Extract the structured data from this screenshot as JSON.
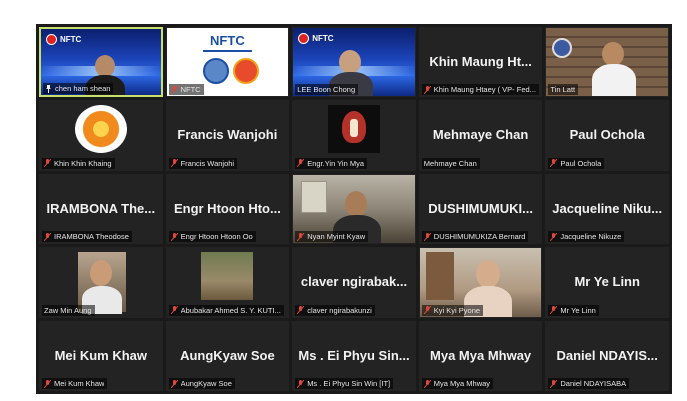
{
  "participants": [
    {
      "display_name": "",
      "caption": "chen ham shean",
      "has_video": true,
      "active": true,
      "pinned": true
    },
    {
      "display_name": "",
      "caption": "NFTC",
      "has_video": true,
      "logo_text": "NFTC"
    },
    {
      "display_name": "",
      "caption": "LEE Boon Chong",
      "has_video": true,
      "badge": "NFTC"
    },
    {
      "display_name": "Khin Maung Ht...",
      "caption": "Khin Maung Htaey ( VP- Fed..."
    },
    {
      "display_name": "",
      "caption": "Tin Latt",
      "has_video": true
    },
    {
      "display_name": "",
      "caption": "Khin Khin Khaing",
      "has_video": true
    },
    {
      "display_name": "Francis Wanjohi",
      "caption": "Francis Wanjohi"
    },
    {
      "display_name": "",
      "caption": "Engr.Yin Yin Mya",
      "has_video": true
    },
    {
      "display_name": "Mehmaye Chan",
      "caption": "Mehmaye Chan"
    },
    {
      "display_name": "Paul Ochola",
      "caption": "Paul Ochola"
    },
    {
      "display_name": "IRAMBONA  The...",
      "caption": "IRAMBONA Theodose"
    },
    {
      "display_name": "Engr Htoon Hto...",
      "caption": "Engr Htoon Htoon Oo"
    },
    {
      "display_name": "",
      "caption": "Nyan Myint Kyaw",
      "has_video": true
    },
    {
      "display_name": "DUSHIMUMUKI...",
      "caption": "DUSHIMUMUKIZA Bernard"
    },
    {
      "display_name": "Jacqueline  Niku...",
      "caption": "Jacqueline Nikuze"
    },
    {
      "display_name": "",
      "caption": "Zaw Min Aung",
      "has_video": true
    },
    {
      "display_name": "",
      "caption": "Abubakar Ahmed S. Y. KUTI...",
      "has_video": true
    },
    {
      "display_name": "claver  ngirabak...",
      "caption": "claver ngirabakunzi"
    },
    {
      "display_name": "",
      "caption": "Kyi Kyi Pyone",
      "has_video": true
    },
    {
      "display_name": "Mr Ye Linn",
      "caption": "Mr Ye Linn"
    },
    {
      "display_name": "Mei Kum Khaw",
      "caption": "Mei Kum Khaw"
    },
    {
      "display_name": "AungKyaw Soe",
      "caption": "AungKyaw Soe"
    },
    {
      "display_name": "Ms . Ei Phyu Sin...",
      "caption": "Ms . Ei Phyu Sin Win [IT]"
    },
    {
      "display_name": "Mya Mya Mhway",
      "caption": "Mya Mya Mhway"
    },
    {
      "display_name": "Daniel  NDAYIS...",
      "caption": "Daniel NDAYISABA"
    }
  ],
  "colors": {
    "grid_background": "#1a1a1a",
    "tile_background": "#232323",
    "active_speaker_border": "#c8e06a",
    "muted_icon": "#e0473c"
  },
  "icons": {
    "muted": "microphone-muted-icon",
    "pinned": "pin-icon"
  }
}
